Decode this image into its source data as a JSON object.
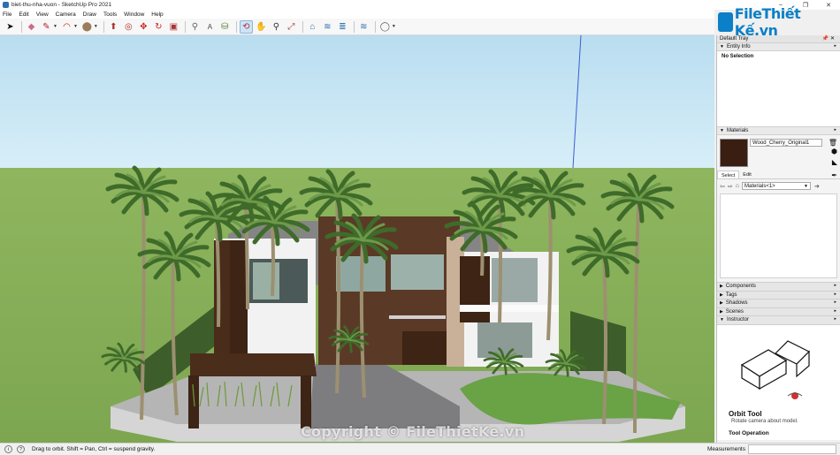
{
  "window": {
    "title": "biet-thu-nha-vuon - SketchUp Pro 2021",
    "controls": [
      "–",
      "❐",
      "✕"
    ]
  },
  "menu": [
    "File",
    "Edit",
    "View",
    "Camera",
    "Draw",
    "Tools",
    "Window",
    "Help"
  ],
  "toolbar": {
    "tools": [
      {
        "name": "select-tool-icon",
        "glyph": "➤"
      },
      {
        "name": "eraser-tool-icon",
        "glyph": "◆"
      },
      {
        "name": "line-tool-icon",
        "glyph": "✎"
      },
      {
        "name": "arc-tool-icon",
        "glyph": "◠"
      },
      {
        "name": "shape-tool-icon",
        "glyph": "⬤"
      },
      {
        "name": "push-pull-tool-icon",
        "glyph": "⬆"
      },
      {
        "name": "offset-tool-icon",
        "glyph": "◎"
      },
      {
        "name": "move-tool-icon",
        "glyph": "✥"
      },
      {
        "name": "rotate-tool-icon",
        "glyph": "↻"
      },
      {
        "name": "scale-tool-icon",
        "glyph": "▣"
      },
      {
        "name": "tape-measure-tool-icon",
        "glyph": "⚲"
      },
      {
        "name": "text-tool-icon",
        "glyph": "A"
      },
      {
        "name": "paint-bucket-tool-icon",
        "glyph": "⛁"
      },
      {
        "name": "orbit-tool-icon",
        "glyph": "⟲"
      },
      {
        "name": "pan-tool-icon",
        "glyph": "✋"
      },
      {
        "name": "zoom-tool-icon",
        "glyph": "⚲"
      },
      {
        "name": "zoom-extents-tool-icon",
        "glyph": "⤢"
      },
      {
        "name": "warehouse-icon",
        "glyph": "⌂"
      },
      {
        "name": "extension-warehouse-icon",
        "glyph": "≋"
      },
      {
        "name": "layout-icon",
        "glyph": "≣"
      },
      {
        "name": "extension-manager-icon",
        "glyph": "≋"
      },
      {
        "name": "account-icon",
        "glyph": "◯"
      }
    ]
  },
  "watermark": {
    "logo_text": "FileThiết Kế.vn"
  },
  "tray": {
    "title": "Default Tray",
    "entity_info": {
      "title": "Entity Info",
      "selection": "No Selection"
    },
    "materials": {
      "title": "Materials",
      "current_name": "Wood_Cherry_Original1",
      "tabs": [
        "Select",
        "Edit"
      ],
      "collection": "Materials<1>"
    },
    "collapsed_panels": [
      "Components",
      "Tags",
      "Shadows",
      "Scenes"
    ],
    "instructor": {
      "title": "Instructor",
      "tool_name": "Orbit Tool",
      "tool_desc": "Rotate camera about model.",
      "operation_label": "Tool Operation"
    }
  },
  "status": {
    "hint": "Drag to orbit.  Shift = Pan, Ctrl = suspend gravity.",
    "measurements_label": "Measurements",
    "measurements_value": ""
  },
  "copyright": "Copyright © FileThietKe.vn",
  "colors": {
    "accent": "#0b7fc7",
    "sky": "#c3e4f4",
    "grass": "#88b05c"
  }
}
